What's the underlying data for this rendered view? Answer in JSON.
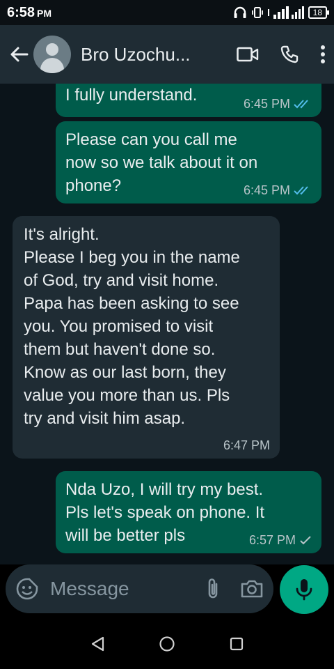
{
  "status_bar": {
    "time": "6:58",
    "period": "PM",
    "battery": "18"
  },
  "header": {
    "contact_name": "Bro Uzochu..."
  },
  "messages": [
    {
      "direction": "outgoing",
      "text": "I fully understand.",
      "time": "6:45 PM",
      "status": "read"
    },
    {
      "direction": "outgoing",
      "text": "Please can you call me\nnow so we talk about it on\nphone?",
      "time": "6:45 PM",
      "status": "read"
    },
    {
      "direction": "incoming",
      "text": "It's alright.\nPlease I beg you in the name\nof God, try and visit home.\nPapa has been asking to see\nyou. You promised to visit\nthem but haven't done so.\nKnow as our last born, they\nvalue you more than us. Pls\ntry and visit him asap.",
      "time": "6:47 PM"
    },
    {
      "direction": "outgoing",
      "text": "Nda Uzo, I will try my best.\nPls let's speak on phone. It\nwill be better pls",
      "time": "6:57 PM",
      "status": "sent"
    }
  ],
  "composer": {
    "placeholder": "Message"
  },
  "colors": {
    "header_bg": "#1f2c34",
    "chat_bg": "#0b141a",
    "outgoing_bubble": "#005c4b",
    "incoming_bubble": "#1f2c34",
    "accent_green": "#00a884",
    "read_tick": "#53bdeb"
  },
  "icons": [
    "back-arrow-icon",
    "avatar-placeholder-icon",
    "video-call-icon",
    "voice-call-icon",
    "more-options-icon",
    "emoji-icon",
    "attach-icon",
    "camera-icon",
    "mic-icon",
    "nav-back-icon",
    "nav-home-icon",
    "nav-recents-icon"
  ]
}
